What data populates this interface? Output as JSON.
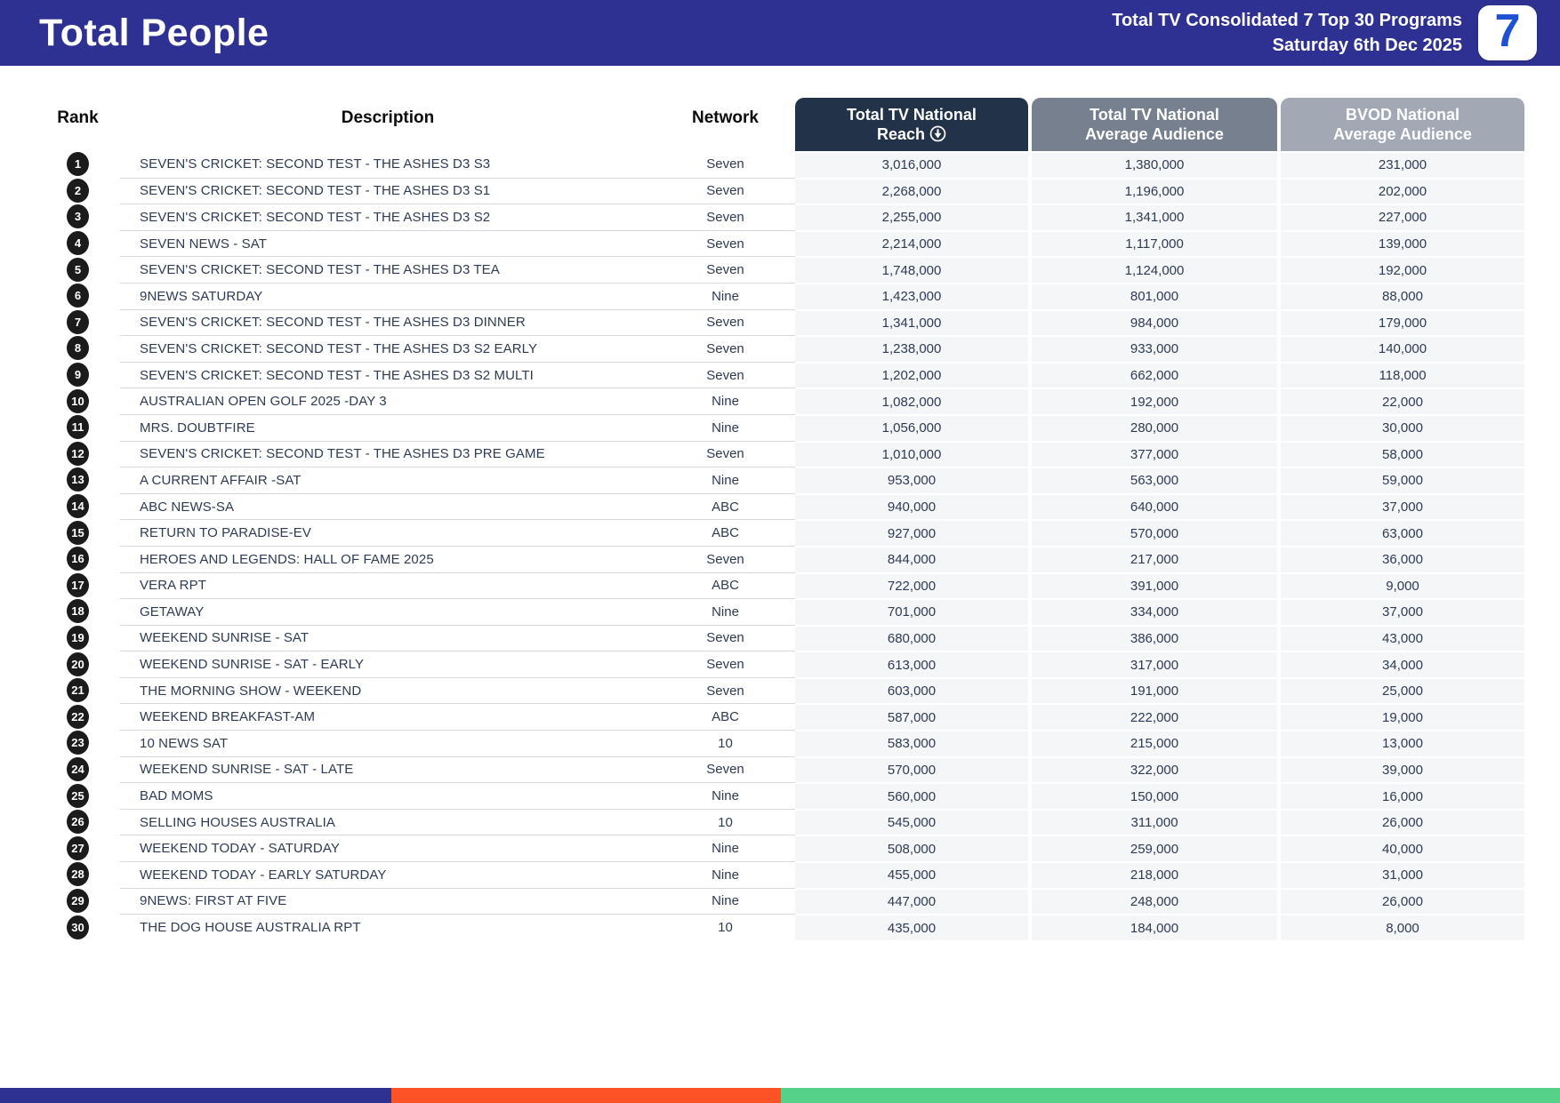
{
  "header": {
    "title": "Total People",
    "subtitle_line1": "Total TV Consolidated 7 Top 30 Programs",
    "subtitle_line2": "Saturday 6th Dec 2025",
    "logo_text": "7",
    "banner_color": "#2e3192",
    "logo_seven_color": "#1d50d2"
  },
  "table": {
    "columns": {
      "rank": "Rank",
      "description": "Description",
      "network": "Network",
      "reach_line1": "Total TV National",
      "reach_line2": "Reach",
      "avg_line1": "Total TV National",
      "avg_line2": "Average Audience",
      "bvod_line1": "BVOD National",
      "bvod_line2": "Average Audience",
      "reach_header_color": "#223349",
      "avg_header_color": "#77808f",
      "bvod_header_color": "#a2a9b4",
      "sort_icon": "circle-down-arrow-icon"
    },
    "rows": [
      {
        "rank": "1",
        "description": "SEVEN'S CRICKET: SECOND TEST - THE ASHES D3 S3",
        "network": "Seven",
        "reach": "3,016,000",
        "avg": "1,380,000",
        "bvod": "231,000"
      },
      {
        "rank": "2",
        "description": "SEVEN'S CRICKET: SECOND TEST - THE ASHES D3 S1",
        "network": "Seven",
        "reach": "2,268,000",
        "avg": "1,196,000",
        "bvod": "202,000"
      },
      {
        "rank": "3",
        "description": "SEVEN'S CRICKET: SECOND TEST - THE ASHES D3 S2",
        "network": "Seven",
        "reach": "2,255,000",
        "avg": "1,341,000",
        "bvod": "227,000"
      },
      {
        "rank": "4",
        "description": "SEVEN NEWS - SAT",
        "network": "Seven",
        "reach": "2,214,000",
        "avg": "1,117,000",
        "bvod": "139,000"
      },
      {
        "rank": "5",
        "description": "SEVEN'S CRICKET: SECOND TEST - THE ASHES D3 TEA",
        "network": "Seven",
        "reach": "1,748,000",
        "avg": "1,124,000",
        "bvod": "192,000"
      },
      {
        "rank": "6",
        "description": "9NEWS SATURDAY",
        "network": "Nine",
        "reach": "1,423,000",
        "avg": "801,000",
        "bvod": "88,000"
      },
      {
        "rank": "7",
        "description": "SEVEN'S CRICKET: SECOND TEST - THE ASHES D3 DINNER",
        "network": "Seven",
        "reach": "1,341,000",
        "avg": "984,000",
        "bvod": "179,000"
      },
      {
        "rank": "8",
        "description": "SEVEN'S CRICKET: SECOND TEST - THE ASHES D3 S2 EARLY",
        "network": "Seven",
        "reach": "1,238,000",
        "avg": "933,000",
        "bvod": "140,000"
      },
      {
        "rank": "9",
        "description": "SEVEN'S CRICKET: SECOND TEST - THE ASHES D3 S2 MULTI",
        "network": "Seven",
        "reach": "1,202,000",
        "avg": "662,000",
        "bvod": "118,000"
      },
      {
        "rank": "10",
        "description": "AUSTRALIAN OPEN GOLF 2025 -DAY 3",
        "network": "Nine",
        "reach": "1,082,000",
        "avg": "192,000",
        "bvod": "22,000"
      },
      {
        "rank": "11",
        "description": "MRS. DOUBTFIRE",
        "network": "Nine",
        "reach": "1,056,000",
        "avg": "280,000",
        "bvod": "30,000"
      },
      {
        "rank": "12",
        "description": "SEVEN'S CRICKET: SECOND TEST - THE ASHES D3 PRE GAME",
        "network": "Seven",
        "reach": "1,010,000",
        "avg": "377,000",
        "bvod": "58,000"
      },
      {
        "rank": "13",
        "description": "A CURRENT AFFAIR -SAT",
        "network": "Nine",
        "reach": "953,000",
        "avg": "563,000",
        "bvod": "59,000"
      },
      {
        "rank": "14",
        "description": "ABC NEWS-SA",
        "network": "ABC",
        "reach": "940,000",
        "avg": "640,000",
        "bvod": "37,000"
      },
      {
        "rank": "15",
        "description": "RETURN TO PARADISE-EV",
        "network": "ABC",
        "reach": "927,000",
        "avg": "570,000",
        "bvod": "63,000"
      },
      {
        "rank": "16",
        "description": "HEROES AND LEGENDS: HALL OF FAME 2025",
        "network": "Seven",
        "reach": "844,000",
        "avg": "217,000",
        "bvod": "36,000"
      },
      {
        "rank": "17",
        "description": "VERA RPT",
        "network": "ABC",
        "reach": "722,000",
        "avg": "391,000",
        "bvod": "9,000"
      },
      {
        "rank": "18",
        "description": "GETAWAY",
        "network": "Nine",
        "reach": "701,000",
        "avg": "334,000",
        "bvod": "37,000"
      },
      {
        "rank": "19",
        "description": "WEEKEND SUNRISE - SAT",
        "network": "Seven",
        "reach": "680,000",
        "avg": "386,000",
        "bvod": "43,000"
      },
      {
        "rank": "20",
        "description": "WEEKEND SUNRISE - SAT - EARLY",
        "network": "Seven",
        "reach": "613,000",
        "avg": "317,000",
        "bvod": "34,000"
      },
      {
        "rank": "21",
        "description": "THE MORNING SHOW - WEEKEND",
        "network": "Seven",
        "reach": "603,000",
        "avg": "191,000",
        "bvod": "25,000"
      },
      {
        "rank": "22",
        "description": "WEEKEND BREAKFAST-AM",
        "network": "ABC",
        "reach": "587,000",
        "avg": "222,000",
        "bvod": "19,000"
      },
      {
        "rank": "23",
        "description": "10 NEWS SAT",
        "network": "10",
        "reach": "583,000",
        "avg": "215,000",
        "bvod": "13,000"
      },
      {
        "rank": "24",
        "description": "WEEKEND SUNRISE - SAT - LATE",
        "network": "Seven",
        "reach": "570,000",
        "avg": "322,000",
        "bvod": "39,000"
      },
      {
        "rank": "25",
        "description": "BAD MOMS",
        "network": "Nine",
        "reach": "560,000",
        "avg": "150,000",
        "bvod": "16,000"
      },
      {
        "rank": "26",
        "description": "SELLING HOUSES AUSTRALIA",
        "network": "10",
        "reach": "545,000",
        "avg": "311,000",
        "bvod": "26,000"
      },
      {
        "rank": "27",
        "description": "WEEKEND TODAY - SATURDAY",
        "network": "Nine",
        "reach": "508,000",
        "avg": "259,000",
        "bvod": "40,000"
      },
      {
        "rank": "28",
        "description": "WEEKEND TODAY - EARLY SATURDAY",
        "network": "Nine",
        "reach": "455,000",
        "avg": "218,000",
        "bvod": "31,000"
      },
      {
        "rank": "29",
        "description": "9NEWS: FIRST AT FIVE",
        "network": "Nine",
        "reach": "447,000",
        "avg": "248,000",
        "bvod": "26,000"
      },
      {
        "rank": "30",
        "description": "THE DOG HOUSE AUSTRALIA RPT",
        "network": "10",
        "reach": "435,000",
        "avg": "184,000",
        "bvod": "8,000"
      }
    ]
  },
  "footer": {
    "segment_colors": [
      "#2e3192",
      "#fd5226",
      "#55d189"
    ]
  }
}
